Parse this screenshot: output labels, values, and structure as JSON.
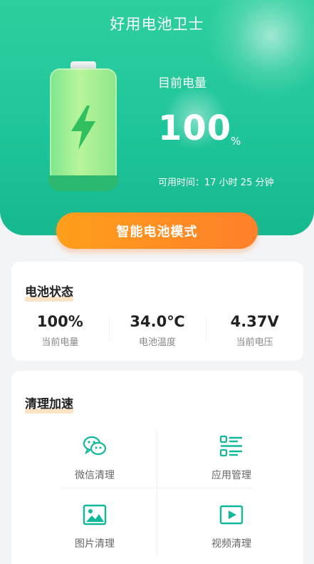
{
  "header": {
    "title": "好用电池卫士",
    "current_label": "目前电量",
    "current_value": "100",
    "current_unit": "%",
    "available_time": "可用时间：17 小时 25 分钟"
  },
  "mode_button": {
    "label": "智能电池模式"
  },
  "battery_status": {
    "title": "电池状态",
    "stats": [
      {
        "value": "100%",
        "label": "当前电量"
      },
      {
        "value": "34.0℃",
        "label": "电池温度"
      },
      {
        "value": "4.37V",
        "label": "当前电压"
      }
    ]
  },
  "cleanup": {
    "title": "清理加速",
    "items": [
      {
        "label": "微信清理",
        "icon": "wechat-icon"
      },
      {
        "label": "应用管理",
        "icon": "app-list-icon"
      },
      {
        "label": "图片清理",
        "icon": "image-icon"
      },
      {
        "label": "视频清理",
        "icon": "video-icon"
      }
    ]
  },
  "colors": {
    "header_green": "#1fc59a",
    "accent_orange": "#ff8a24",
    "icon_teal": "#12b89a"
  }
}
